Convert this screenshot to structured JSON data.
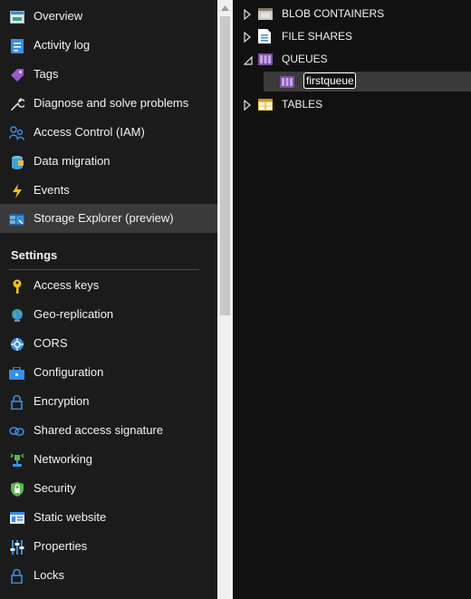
{
  "sidebar": {
    "items": [
      {
        "label": "Overview",
        "icon": "overview-icon"
      },
      {
        "label": "Activity log",
        "icon": "activity-log-icon"
      },
      {
        "label": "Tags",
        "icon": "tag-icon"
      },
      {
        "label": "Diagnose and solve problems",
        "icon": "wrench-icon"
      },
      {
        "label": "Access Control (IAM)",
        "icon": "people-icon"
      },
      {
        "label": "Data migration",
        "icon": "data-migration-icon"
      },
      {
        "label": "Events",
        "icon": "lightning-icon"
      },
      {
        "label": "Storage Explorer (preview)",
        "icon": "storage-explorer-icon",
        "active": true
      }
    ],
    "settings_title": "Settings",
    "settings_items": [
      {
        "label": "Access keys",
        "icon": "key-icon"
      },
      {
        "label": "Geo-replication",
        "icon": "globe-icon"
      },
      {
        "label": "CORS",
        "icon": "cors-icon"
      },
      {
        "label": "Configuration",
        "icon": "configuration-icon"
      },
      {
        "label": "Encryption",
        "icon": "lock-icon"
      },
      {
        "label": "Shared access signature",
        "icon": "link-icon"
      },
      {
        "label": "Networking",
        "icon": "networking-icon"
      },
      {
        "label": "Security",
        "icon": "shield-icon"
      },
      {
        "label": "Static website",
        "icon": "static-website-icon"
      },
      {
        "label": "Properties",
        "icon": "properties-icon"
      },
      {
        "label": "Locks",
        "icon": "lock-icon"
      }
    ]
  },
  "explorer": {
    "nodes": [
      {
        "label": "BLOB CONTAINERS",
        "icon": "blob-containers-icon",
        "expanded": false
      },
      {
        "label": "FILE SHARES",
        "icon": "file-shares-icon",
        "expanded": false
      },
      {
        "label": "QUEUES",
        "icon": "queues-icon",
        "expanded": true
      },
      {
        "label": "TABLES",
        "icon": "tables-icon",
        "expanded": false
      }
    ],
    "queue_child": {
      "value": "firstqueue",
      "icon": "queue-icon"
    }
  },
  "colors": {
    "sidebar_bg": "#1b1b1b",
    "active_bg": "#3a3a3a",
    "explorer_bg": "#111111",
    "accent_blue": "#3a8ee6"
  }
}
